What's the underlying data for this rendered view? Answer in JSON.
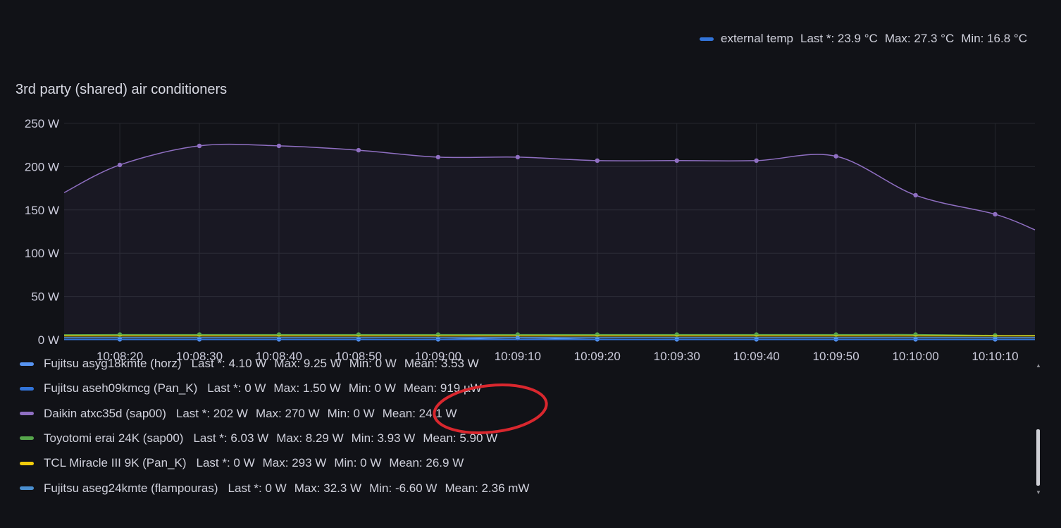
{
  "top_legend": {
    "series_name": "external temp",
    "color": "#3274d9",
    "stats": [
      "Last *: 23.9 °C",
      "Max: 27.3 °C",
      "Min: 16.8 °C"
    ]
  },
  "panel": {
    "title": "3rd party (shared) air conditioners"
  },
  "chart_data": {
    "type": "line",
    "title": "3rd party (shared) air conditioners",
    "y_unit": "W",
    "ylim": [
      0,
      250
    ],
    "y_ticks": [
      "0 W",
      "50 W",
      "100 W",
      "150 W",
      "200 W",
      "250 W"
    ],
    "x_ticks": [
      "10:08:20",
      "10:08:30",
      "10:08:40",
      "10:08:50",
      "10:09:00",
      "10:09:10",
      "10:09:20",
      "10:09:30",
      "10:09:40",
      "10:09:50",
      "10:10:00",
      "10:10:10"
    ],
    "x_range": [
      "10:08:13",
      "10:10:15"
    ],
    "grid": true,
    "series": [
      {
        "name": "Daikin atxc35d (sap00)",
        "color": "#8f6fc2",
        "x": [
          "10:08:13",
          "10:08:20",
          "10:08:30",
          "10:08:40",
          "10:08:50",
          "10:09:00",
          "10:09:10",
          "10:09:20",
          "10:09:30",
          "10:09:40",
          "10:09:50",
          "10:10:00",
          "10:10:10",
          "10:10:15"
        ],
        "values": [
          170,
          202,
          224,
          224,
          219,
          211,
          211,
          207,
          207,
          207,
          212,
          167,
          145,
          127
        ],
        "points": [
          false,
          true,
          true,
          true,
          true,
          true,
          true,
          true,
          true,
          true,
          true,
          true,
          true,
          false
        ]
      },
      {
        "name": "Toyotomi erai 24K (sap00)",
        "color": "#56a64b",
        "x": [
          "10:08:13",
          "10:08:20",
          "10:08:30",
          "10:08:40",
          "10:08:50",
          "10:09:00",
          "10:09:10",
          "10:09:20",
          "10:09:30",
          "10:09:40",
          "10:09:50",
          "10:10:00",
          "10:10:10",
          "10:10:15"
        ],
        "values": [
          5.8,
          6,
          6,
          6,
          6,
          6,
          6,
          6,
          6,
          6,
          6,
          6,
          5,
          5
        ],
        "points": [
          false,
          true,
          true,
          true,
          true,
          true,
          true,
          true,
          true,
          true,
          true,
          true,
          true,
          false
        ]
      },
      {
        "name": "TCL Miracle III 9K (Pan_K)",
        "color": "#f2cc0c",
        "x": [
          "10:08:13",
          "10:10:15"
        ],
        "values": [
          4.5,
          4.5
        ],
        "points": [
          false,
          false
        ]
      },
      {
        "name": "Fujitsu asyg18kmte (horz)",
        "color": "#5794f2",
        "x": [
          "10:08:13",
          "10:08:20",
          "10:08:30",
          "10:08:40",
          "10:08:50",
          "10:09:00",
          "10:09:10",
          "10:09:20",
          "10:09:30",
          "10:09:40",
          "10:09:50",
          "10:10:00",
          "10:10:10",
          "10:10:15"
        ],
        "values": [
          0.5,
          0.5,
          0.5,
          0.5,
          0.5,
          0.5,
          2,
          0.5,
          0.5,
          0.5,
          0.5,
          0.5,
          0.5,
          0.5
        ],
        "points": [
          false,
          true,
          true,
          true,
          true,
          true,
          true,
          true,
          true,
          true,
          true,
          true,
          true,
          false
        ]
      },
      {
        "name": "Fujitsu aseh09kmcg (Pan_K)",
        "color": "#3274d9",
        "x": [
          "10:08:13",
          "10:10:15"
        ],
        "values": [
          0.2,
          0.2
        ],
        "points": [
          false,
          false
        ]
      },
      {
        "name": "Fujitsu aseg24kmte (flampouras)",
        "color": "#4a8fd0",
        "x": [
          "10:08:13",
          "10:10:15"
        ],
        "values": [
          2.5,
          2.5
        ],
        "points": [
          false,
          false
        ]
      }
    ]
  },
  "legend": {
    "rows": [
      {
        "name": "Fujitsu asyg18kmte (horz)",
        "color": "#5794f2",
        "stats": [
          "Last *: 4.10 W",
          "Max: 9.25 W",
          "Min: 0 W",
          "Mean: 3.53 W"
        ]
      },
      {
        "name": "Fujitsu aseh09kmcg (Pan_K)",
        "color": "#3274d9",
        "stats": [
          "Last *: 0 W",
          "Max: 1.50 W",
          "Min: 0 W",
          "Mean: 919 µW"
        ]
      },
      {
        "name": "Daikin atxc35d (sap00)",
        "color": "#8f6fc2",
        "stats": [
          "Last *: 202 W",
          "Max: 270 W",
          "Min: 0 W",
          "Mean: 24.1 W"
        ]
      },
      {
        "name": "Toyotomi erai 24K (sap00)",
        "color": "#56a64b",
        "stats": [
          "Last *: 6.03 W",
          "Max: 8.29 W",
          "Min: 3.93 W",
          "Mean: 5.90 W"
        ]
      },
      {
        "name": "TCL Miracle III 9K (Pan_K)",
        "color": "#f2cc0c",
        "stats": [
          "Last *: 0 W",
          "Max: 293 W",
          "Min: 0 W",
          "Mean: 26.9 W"
        ]
      },
      {
        "name": "Fujitsu aseg24kmte (flampouras)",
        "color": "#4a8fd0",
        "stats": [
          "Last *: 0 W",
          "Max: 32.3 W",
          "Min: -6.60 W",
          "Mean: 2.36 mW"
        ]
      }
    ]
  },
  "scrollbar": {
    "up_icon": "triangle-up-icon",
    "down_icon": "triangle-down-icon"
  },
  "annotation": {
    "shape": "ellipse",
    "color": "#d9272e"
  }
}
